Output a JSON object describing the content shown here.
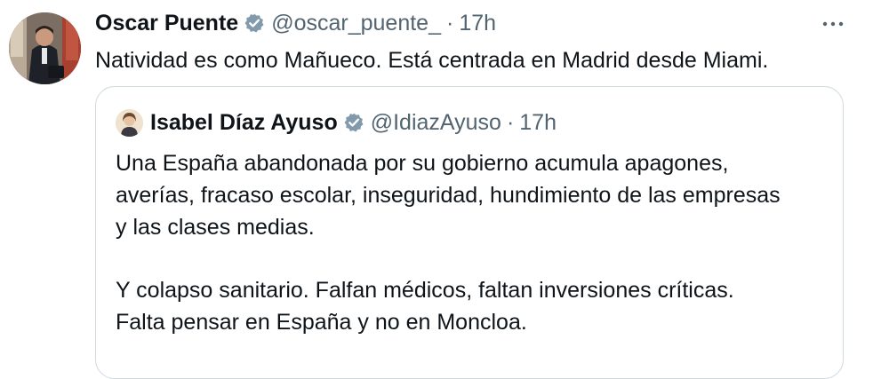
{
  "tweet": {
    "author_name": "Oscar Puente",
    "author_handle": "@oscar_puente_",
    "separator": "·",
    "time": "17h",
    "text": "Natividad es como Mañueco. Está centrada en Madrid desde Miami.",
    "more_icon": "more-horizontal-icon"
  },
  "quoted": {
    "author_name": "Isabel Díaz Ayuso",
    "author_handle": "@IdiazAyuso",
    "separator": "·",
    "time": "17h",
    "paragraph1": [
      "Una España abandonada por su gobierno acumula apagones,",
      "averías, fracaso escolar, inseguridad, hundimiento de las empresas",
      "y las clases medias."
    ],
    "paragraph2": [
      "Y colapso sanitario. Falfan médicos, faltan inversiones críticas.",
      "Falta pensar en España y no en Moncloa."
    ]
  },
  "colors": {
    "text": "#0f1419",
    "secondary": "#536471",
    "border": "#cfd9de",
    "verified_badge": "#829aab"
  }
}
